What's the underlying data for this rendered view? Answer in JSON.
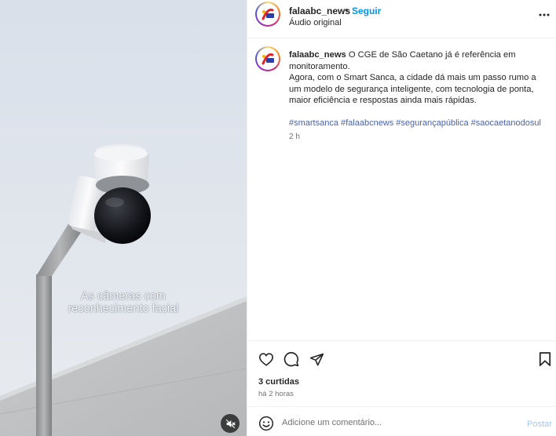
{
  "media": {
    "subtitle_line1": "As câmeras com",
    "subtitle_line2": "reconhecimento facial",
    "mute_icon": "speaker-muted-icon"
  },
  "header": {
    "username": "falaabc_news",
    "separator": "•",
    "follow_label": "Seguir",
    "audio_label": "Áudio original",
    "more_icon": "more-horizontal-icon"
  },
  "caption": {
    "username": "falaabc_news",
    "lines": [
      "O CGE de São Caetano já é referência em",
      "monitoramento.",
      "Agora, com o Smart Sanca, a cidade dá mais um passo rumo a",
      "um modelo de segurança inteligente, com tecnologia de ponta,",
      "maior eficiência e respostas ainda mais rápidas."
    ],
    "hashtags": [
      "#smartsanca",
      "#falaabcnews",
      "#segurançapública",
      "#saocaetanodosul"
    ],
    "time": "2 h"
  },
  "actions": {
    "like_icon": "heart-icon",
    "comment_icon": "comment-icon",
    "share_icon": "send-icon",
    "save_icon": "bookmark-icon",
    "likes_text": "3 curtidas",
    "posted_text": "há 2 horas"
  },
  "comment": {
    "placeholder": "Adicione um comentário...",
    "post_label": "Postar",
    "emoji_icon": "emoji-icon"
  },
  "colors": {
    "link_blue": "#0095f6",
    "hashtag_blue": "#4a62b0",
    "post_disabled": "#a8c7fa",
    "muted_text": "#737373"
  }
}
